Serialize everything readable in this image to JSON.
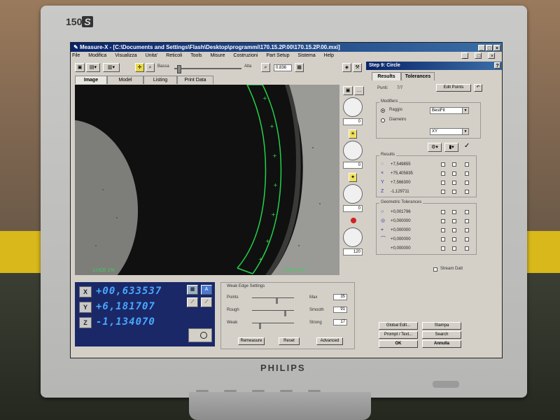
{
  "monitor": {
    "model": "150",
    "model_suffix": "S",
    "brand": "PHILIPS"
  },
  "window": {
    "title": "Measure-X - [C:\\Documents and Settings\\Flash\\Desktop\\programmi\\170.15.2P.00\\170.15.2P.00.mxi]",
    "buttons": [
      "_",
      "□",
      "×"
    ],
    "inner_buttons": [
      "_",
      "□",
      "×"
    ]
  },
  "menu": [
    "File",
    "Modifica",
    "Visualizza",
    "Unita'",
    "Reticoli",
    "Tools",
    "Misure",
    "Costruzioni",
    "Part Setup",
    "Sistema",
    "Help"
  ],
  "toolbar": {
    "bassa": "Bassa",
    "alta": "Alta",
    "zoom_value": "0.836"
  },
  "tabs": [
    "Image",
    "Model",
    "Listing",
    "Print Data"
  ],
  "camera": {
    "luce_label": "LUCE  1%",
    "luce_right_label": "LUCE  1%"
  },
  "side_dials": [
    "0",
    "0",
    "0",
    "120"
  ],
  "coords": {
    "x_label": "X",
    "y_label": "Y",
    "z_label": "Z",
    "x": "+00,633537",
    "y": "+6,181707",
    "z": "-1,134070"
  },
  "edge_settings": {
    "title": "Weak Edge Settings",
    "rows": [
      {
        "left": "Points",
        "right": "Max",
        "value": "35"
      },
      {
        "left": "Rough",
        "right": "Smooth",
        "value": "91"
      },
      {
        "left": "Weak",
        "right": "Strong",
        "value": "17"
      }
    ],
    "buttons": {
      "remeasure": "Remeasure",
      "reset": "Reset",
      "advanced": "Advanced"
    }
  },
  "step": {
    "title": "Step   9:  Circle",
    "help": "?",
    "tabs": [
      "Results",
      "Tolerances"
    ],
    "punti_label": "Punti:",
    "punti_value": "7/7",
    "edit_points": "Edit Points",
    "undo": "↶",
    "modifiers": {
      "title": "Modifiers",
      "raggio": "Raggio",
      "diametro": "Diametro",
      "fit": "BestFit",
      "plane": "XY"
    },
    "results": {
      "title": "Results",
      "rows": [
        {
          "icon": "circle-icon",
          "value": "+7,549855"
        },
        {
          "icon": "x-axis-icon",
          "value": "+75,405835"
        },
        {
          "icon": "y-axis-icon",
          "value": "+7,566300"
        },
        {
          "icon": "z-axis-icon",
          "value": "-1,129711"
        }
      ]
    },
    "geometric": {
      "title": "Geometric Tolerances",
      "rows": [
        {
          "icon": "circularity-icon",
          "value": "+0,001796"
        },
        {
          "icon": "cylindricity-icon",
          "value": "+0,000000"
        },
        {
          "icon": "position-icon",
          "value": "+0,000000"
        },
        {
          "icon": "profile-icon",
          "value": "+0,000000"
        },
        {
          "icon": "blank-icon",
          "value": "+0,000000"
        }
      ]
    },
    "stream_datt": "Stream Datt",
    "buttons": {
      "global_edit": "Global Edit...",
      "stampa": "Stampa",
      "prompt_text": "Prompt / Text...",
      "search": "Search",
      "ok": "OK",
      "annulla": "Annulla"
    }
  }
}
